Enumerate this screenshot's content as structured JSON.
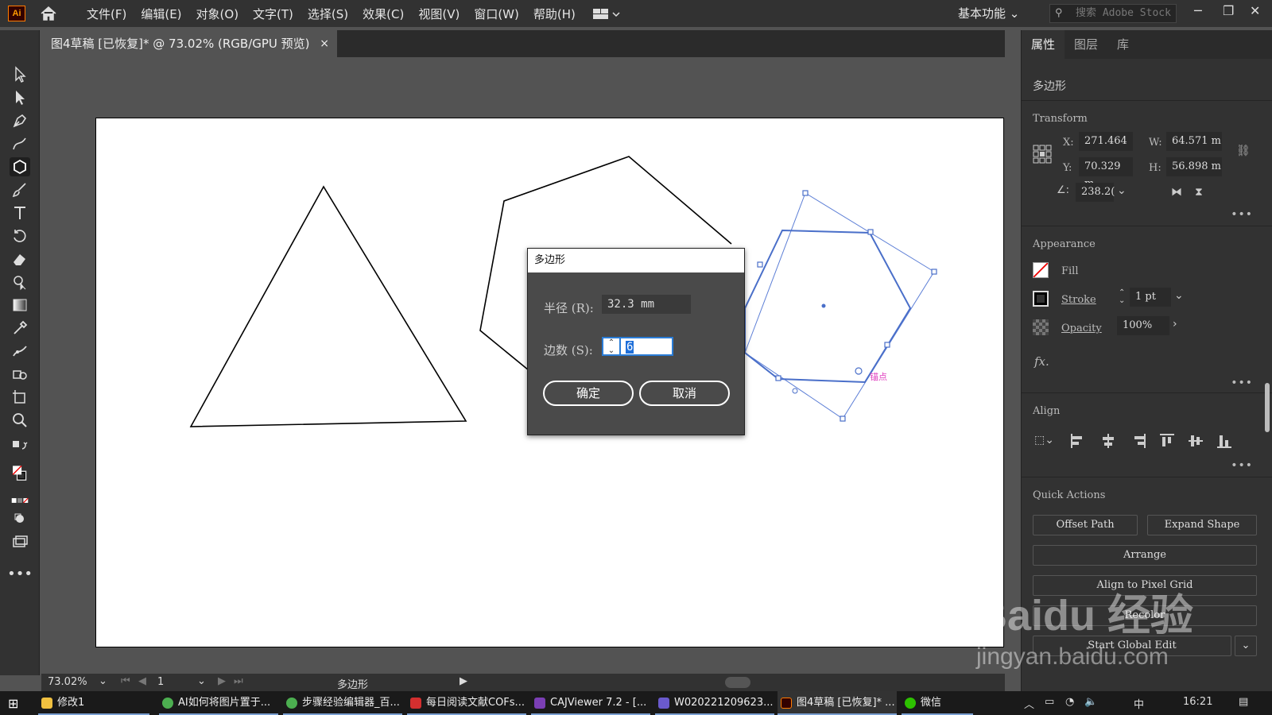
{
  "app": {
    "logo": "Ai",
    "workspace": "基本功能",
    "search_placeholder": "搜索 Adobe Stock"
  },
  "menu": [
    "文件(F)",
    "编辑(E)",
    "对象(O)",
    "文字(T)",
    "选择(S)",
    "效果(C)",
    "视图(V)",
    "窗口(W)",
    "帮助(H)"
  ],
  "document_tab": {
    "title": "图4草稿 [已恢复]* @ 73.02% (RGB/GPU 预览)",
    "close": "×"
  },
  "anchor_hint": "锚点",
  "dialog": {
    "title": "多边形",
    "radius_label": "半径 (R):",
    "radius_value": "32.3 mm",
    "sides_label": "边数 (S):",
    "sides_value": "6",
    "ok": "确定",
    "cancel": "取消"
  },
  "status": {
    "zoom": "73.02%",
    "page": "1",
    "object": "多边形"
  },
  "panel": {
    "tabs": [
      "属性",
      "图层",
      "库"
    ],
    "object_type": "多边形",
    "transform": {
      "label": "Transform",
      "x_label": "X:",
      "x": "271.464",
      "y_label": "Y:",
      "y": "70.329 m",
      "w_label": "W:",
      "w": "64.571 m",
      "h_label": "H:",
      "h": "56.898 m",
      "angle": "238.2("
    },
    "appearance": {
      "label": "Appearance",
      "fill": "Fill",
      "stroke": "Stroke",
      "stroke_weight": "1 pt",
      "opacity": "Opacity",
      "opacity_value": "100%",
      "fx": "fx."
    },
    "align": {
      "label": "Align"
    },
    "quick_actions": {
      "label": "Quick Actions",
      "offset_path": "Offset Path",
      "expand_shape": "Expand Shape",
      "arrange": "Arrange",
      "align_pixel": "Align to Pixel Grid",
      "recolor": "Recolor",
      "start_global_edit": "Start Global Edit"
    }
  },
  "taskbar": {
    "items": [
      "修改1",
      "AI如何将图片置于...",
      "步骤经验编辑器_百...",
      "每日阅读文献COFs...",
      "CAJViewer 7.2 - [...",
      "W020221209623...",
      "图4草稿 [已恢复]* ...",
      "微信"
    ],
    "ime": "中",
    "time": "16:21"
  },
  "watermark": {
    "brand": "Baidu 经验",
    "url": "jingyan.baidu.com"
  },
  "colors": {
    "accent": "#2a7cd6",
    "selection": "#4a6fc9",
    "anchor_text": "#e040c0"
  }
}
